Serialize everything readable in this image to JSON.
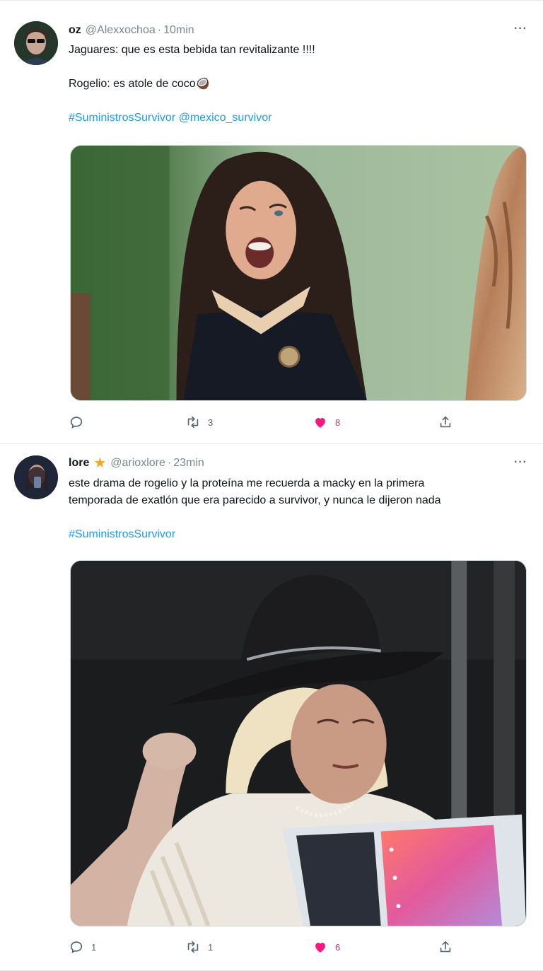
{
  "tweets": [
    {
      "name": "oz",
      "handle": "@Alexxochoa",
      "separator": "·",
      "time": "10min",
      "more": "···",
      "lines": [
        "Jaguares: que es esta bebida tan revitalizante !!!!",
        "",
        "Rogelio: es atole de coco🥥",
        "",
        "#SuministrosSurvivor @mexico_survivor"
      ],
      "actions": {
        "reply": "",
        "retweet": "3",
        "like": "8"
      },
      "icons": {
        "reply": "reply-icon",
        "retweet": "retweet-icon",
        "like": "heart-icon",
        "share": "share-icon"
      }
    },
    {
      "name": "lore",
      "badge": "★",
      "handle": "@arioxlore",
      "separator": "·",
      "time": "23min",
      "more": "···",
      "lines": [
        "este drama de rogelio y la proteína me recuerda a macky en la primera",
        "temporada de exatlón que era parecido a survivor, y nunca le dijeron nada",
        "",
        "#SuministrosSurvivor"
      ],
      "actions": {
        "reply": "1",
        "retweet": "1",
        "like": "6"
      },
      "icons": {
        "reply": "reply-icon",
        "retweet": "retweet-icon",
        "like": "heart-icon",
        "share": "share-icon"
      }
    }
  ],
  "colors": {
    "link": "#1d9bf0",
    "like": "#f91880",
    "muted": "#536471",
    "star": "#f5a623"
  }
}
